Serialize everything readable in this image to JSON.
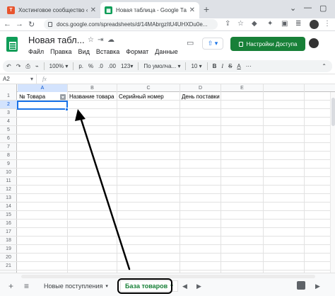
{
  "browser": {
    "tabs": [
      {
        "title": "Хостинговое сообщество «Tim",
        "favicon": "T",
        "active": false
      },
      {
        "title": "Новая таблица - Google Табли",
        "favicon": "",
        "active": true
      }
    ],
    "new_tab": "+",
    "url": "docs.google.com/spreadsheets/d/14MAbrgzItU4UHXDu0e..."
  },
  "doc": {
    "title": "Новая табл...",
    "menu": [
      "Файл",
      "Правка",
      "Вид",
      "Вставка",
      "Формат",
      "Данные"
    ],
    "share_label": "Настройки Доступа",
    "accent_color": "#188038"
  },
  "toolbar": {
    "zoom": "100%",
    "currency": "р.",
    "percent": "%",
    "dec_dec": ".0",
    "dec_inc": ".00",
    "more_formats": "123",
    "font": "По умолча...",
    "font_size": "10",
    "bold": "B",
    "italic": "I",
    "strike": "S",
    "text_color": "A"
  },
  "formula_bar": {
    "cell_ref": "A2",
    "fx": "fx",
    "value": ""
  },
  "grid": {
    "columns": [
      "A",
      "B",
      "C",
      "D",
      "E"
    ],
    "rows": [
      "1",
      "2",
      "3",
      "4",
      "5",
      "6",
      "7",
      "8",
      "9",
      "10",
      "11",
      "12",
      "13",
      "14",
      "15",
      "16",
      "17",
      "18",
      "19",
      "20",
      "21"
    ],
    "header_cells": [
      "№ Товара",
      "Название товара",
      "Серийный номер",
      "День поставки",
      ""
    ],
    "selected_cell": "A2"
  },
  "sheets": {
    "add_label": "+",
    "list_label": "≡",
    "tabs": [
      {
        "label": "Новые поступления",
        "active": false
      },
      {
        "label": "База товаров",
        "active": true
      }
    ]
  }
}
